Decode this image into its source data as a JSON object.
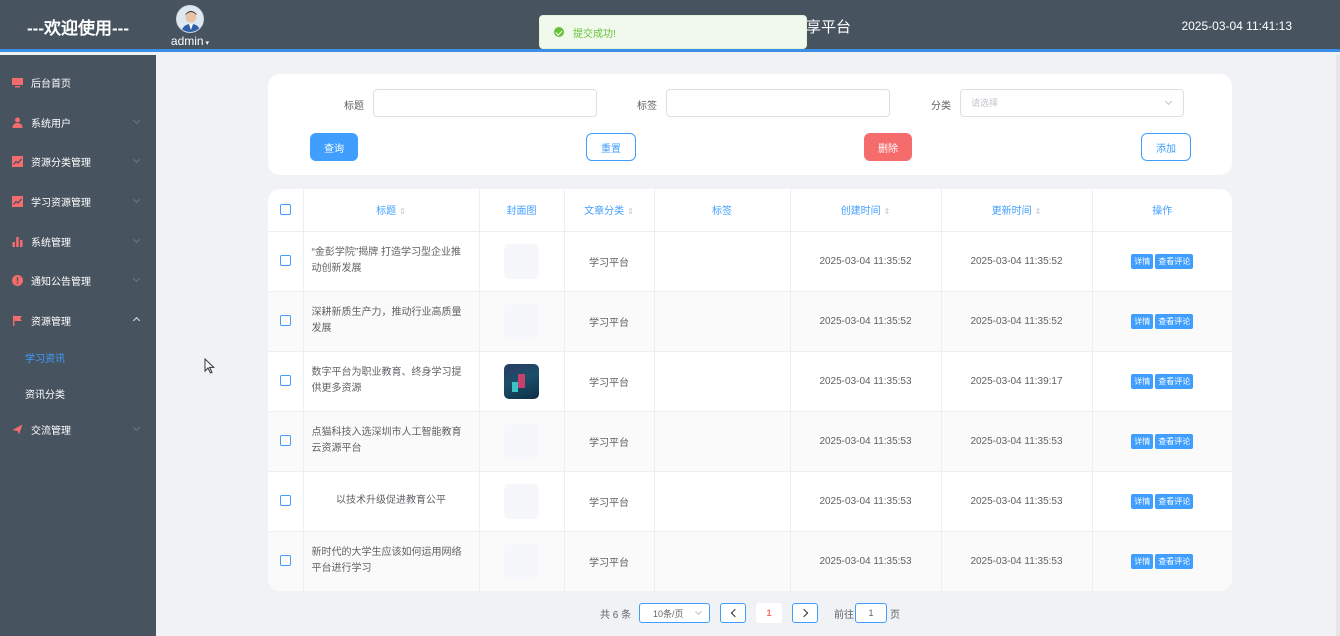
{
  "header": {
    "welcome": "---欢迎使用---",
    "admin_name": "admin",
    "site_title_partial": "享平台",
    "datetime": "2025-03-04 11:41:13"
  },
  "toast": {
    "message": "提交成功!"
  },
  "sidebar": {
    "items": [
      {
        "label": "后台首页",
        "icon": "monitor-icon",
        "color": "#f56c6c"
      },
      {
        "label": "系统用户",
        "icon": "user-icon",
        "color": "#f56c6c"
      },
      {
        "label": "资源分类管理",
        "icon": "chart-icon",
        "color": "#f56c6c"
      },
      {
        "label": "学习资源管理",
        "icon": "chart-icon",
        "color": "#f56c6c"
      },
      {
        "label": "系统管理",
        "icon": "bars-icon",
        "color": "#f56c6c"
      },
      {
        "label": "通知公告管理",
        "icon": "alert-icon",
        "color": "#f56c6c"
      },
      {
        "label": "资源管理",
        "icon": "flag-icon",
        "color": "#f56c6c"
      },
      {
        "label": "交流管理",
        "icon": "send-icon",
        "color": "#f56c6c"
      }
    ],
    "sub_items": [
      {
        "label": "学习资讯",
        "active": true
      },
      {
        "label": "资讯分类",
        "active": false
      }
    ]
  },
  "search": {
    "title_label": "标题",
    "tag_label": "标签",
    "category_label": "分类",
    "category_placeholder": "请选择",
    "query_btn": "查询",
    "reset_btn": "重置",
    "delete_btn": "删除",
    "add_btn": "添加"
  },
  "table": {
    "headers": [
      "标题",
      "封面图",
      "文章分类",
      "标签",
      "创建时间",
      "更新时间",
      "操作"
    ],
    "rows": [
      {
        "title": "“金彭学院”揭牌 打造学习型企业推动创新发展",
        "category": "学习平台",
        "tag": "",
        "created": "2025-03-04 11:35:52",
        "updated": "2025-03-04 11:35:52"
      },
      {
        "title": "深耕新质生产力，推动行业高质量发展",
        "category": "学习平台",
        "tag": "",
        "created": "2025-03-04 11:35:52",
        "updated": "2025-03-04 11:35:52"
      },
      {
        "title": "数字平台为职业教育、终身学习提供更多资源",
        "category": "学习平台",
        "tag": "",
        "created": "2025-03-04 11:35:53",
        "updated": "2025-03-04 11:39:17"
      },
      {
        "title": "点猫科技入选深圳市人工智能教育云资源平台",
        "category": "学习平台",
        "tag": "",
        "created": "2025-03-04 11:35:53",
        "updated": "2025-03-04 11:35:53"
      },
      {
        "title": "以技术升级促进教育公平",
        "category": "学习平台",
        "tag": "",
        "created": "2025-03-04 11:35:53",
        "updated": "2025-03-04 11:35:53"
      },
      {
        "title": "新时代的大学生应该如何运用网络平台进行学习",
        "category": "学习平台",
        "tag": "",
        "created": "2025-03-04 11:35:53",
        "updated": "2025-03-04 11:35:53"
      }
    ],
    "detail_btn": "详情",
    "comments_btn": "查看评论"
  },
  "pagination": {
    "total": "共 6 条",
    "page_size": "10条/页",
    "current_page": "1",
    "goto_label": "前往",
    "goto_value": "1",
    "page_suffix": "页"
  },
  "colors": {
    "sidebar_bg": "#47535f",
    "accent": "#409eff",
    "danger": "#f56c6c",
    "success": "#67c23a"
  }
}
